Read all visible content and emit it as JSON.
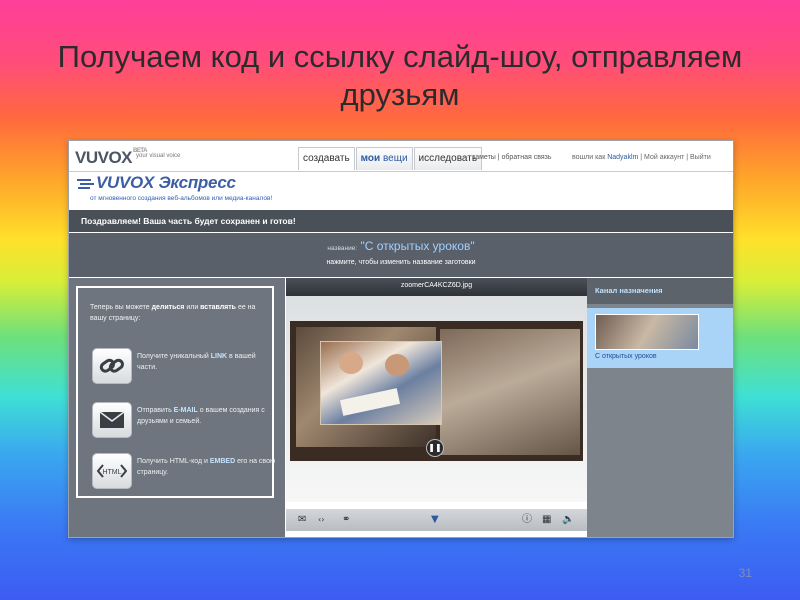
{
  "slide": {
    "title_line1": "Получаем код и ссылку слайд-шоу, отправляем",
    "title_line2": "друзьям",
    "number": "31"
  },
  "topbar": {
    "logo": "VUVOX",
    "logo_badge": "BETA",
    "tagline": "your visual voice",
    "tabs": [
      {
        "label": "создавать"
      },
      {
        "label_bold": "мои",
        "label_rest": "вещи"
      },
      {
        "label": "исследовать"
      }
    ],
    "links": "заметы | обратная связь",
    "signed_in_as": "вошли как",
    "username": "Nadyaklm",
    "my_account": "| Мой аккаунт |",
    "logout": "Выйти"
  },
  "header": {
    "title": "VUVOX Экспресс",
    "subtitle": "от мгновенного создания веб-альбомов или медиа-каналов!"
  },
  "congrats": "Поздравляем! Ваша часть будет сохранен и готов!",
  "name_bar": {
    "label": "название:",
    "value": "\"С открытых уроков\"",
    "hint": "нажмите, чтобы изменить название заготовки"
  },
  "share_panel": {
    "intro_a": "Теперь вы можете ",
    "intro_share": "делиться",
    "intro_or": " или ",
    "intro_embed": "вставлять",
    "intro_b": " ее на вашу страницу:",
    "link_a": "Получите уникальный ",
    "link_hl": "LINK",
    "link_b": " в вашей части.",
    "email_a": "Отправить ",
    "email_hl": "E-MAIL",
    "email_b": " о вашем создания с друзьями и семьей.",
    "html_a": "Получить HTML-код и ",
    "html_hl": "EMBED",
    "html_b": " его на свою страницу.",
    "html_icon_text": "HTML"
  },
  "player": {
    "filename": "zoomerCA4KCZ6D.jpg"
  },
  "channel": {
    "header": "Канал назначения",
    "item_label": "С открытых уроков"
  }
}
